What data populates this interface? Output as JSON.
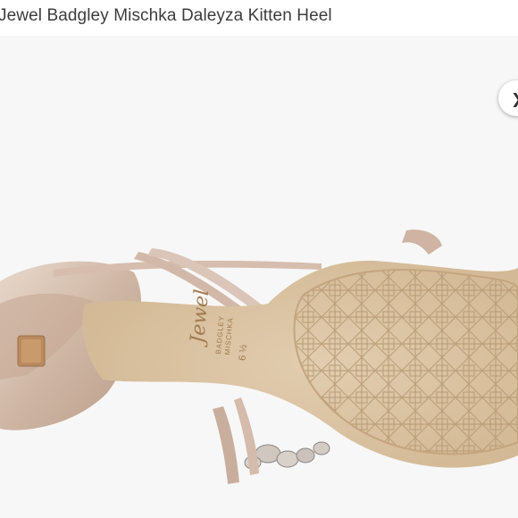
{
  "product": {
    "title": "Jewel Badgley Mischka Daleyza Kitten Heel"
  },
  "photo": {
    "alt": "Shoe sole view",
    "brand_script": "Jewel",
    "brand_line1": "BADGLEY",
    "brand_line2": "MISCHKA",
    "size_label": "6 ½"
  },
  "gallery": {
    "next_icon": "chevron-right-icon",
    "next_glyph": "❯"
  },
  "colors": {
    "background": "#f7f7f7",
    "sole": "#dcc4a4",
    "satin": "#d9c2b2",
    "heel_tip": "#b98a5e"
  }
}
